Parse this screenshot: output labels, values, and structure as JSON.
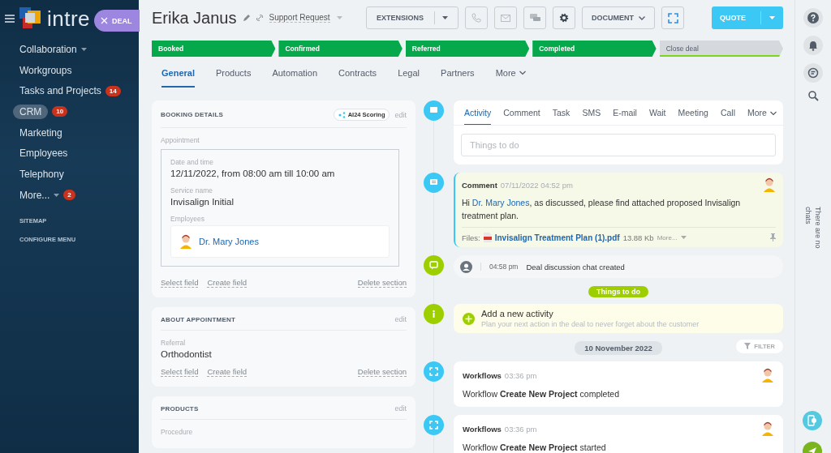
{
  "sidebar": {
    "logo": "intre",
    "deal_button": "DEAL",
    "items": [
      {
        "label": "Collaboration",
        "caret": true,
        "selected": false
      },
      {
        "label": "Workgroups",
        "caret": false,
        "selected": false
      },
      {
        "label": "Tasks and Projects",
        "badge": "14",
        "caret": false,
        "selected": false
      },
      {
        "label": "CRM",
        "badge": "10",
        "caret": false,
        "selected": true
      },
      {
        "label": "Marketing",
        "caret": false,
        "selected": false
      },
      {
        "label": "Employees",
        "caret": false,
        "selected": false
      },
      {
        "label": "Telephony",
        "caret": false,
        "selected": false
      },
      {
        "label": "More...",
        "badge": "2",
        "caret": true,
        "selected": false
      }
    ],
    "links": [
      "SITEMAP",
      "CONFIGURE MENU"
    ]
  },
  "header": {
    "title": "Erika Janus",
    "category": "Support Request",
    "extensions": "EXTENSIONS",
    "document": "DOCUMENT",
    "quote": "QUOTE"
  },
  "stages": [
    {
      "label": "Booked",
      "done": true
    },
    {
      "label": "Confirmed",
      "done": true
    },
    {
      "label": "Referred",
      "done": true
    },
    {
      "label": "Completed",
      "done": true
    },
    {
      "label": "Close deal",
      "done": false
    }
  ],
  "tabs": [
    {
      "label": "General",
      "selected": true
    },
    {
      "label": "Products",
      "selected": false
    },
    {
      "label": "Automation",
      "selected": false
    },
    {
      "label": "Contracts",
      "selected": false
    },
    {
      "label": "Legal",
      "selected": false
    },
    {
      "label": "Partners",
      "selected": false
    },
    {
      "label": "More",
      "selected": false
    }
  ],
  "sections": [
    {
      "title": "BOOKING DETAILS",
      "scoring": "AI24 Scoring",
      "edit": "edit",
      "kind": "booking",
      "group_label": "Appointment",
      "fields": [
        {
          "label": "Date and time",
          "value": "12/11/2022, from 08:00 am till 10:00 am"
        },
        {
          "label": "Service name",
          "value": "Invisalign Initial"
        }
      ],
      "employees_label": "Employees",
      "employee": "Dr. Mary Jones",
      "actions": [
        "Select field",
        "Create field"
      ],
      "delete": "Delete section"
    },
    {
      "title": "ABOUT APPOINTMENT",
      "edit": "edit",
      "kind": "plain",
      "fields": [
        {
          "label": "Referral",
          "value": "Orthodontist"
        }
      ],
      "actions": [
        "Select field",
        "Create field"
      ],
      "delete": "Delete section"
    },
    {
      "title": "PRODUCTS",
      "edit": "edit",
      "kind": "plain",
      "fields": [
        {
          "label": "Procedure"
        }
      ]
    }
  ],
  "activity_tabs": [
    {
      "label": "Activity",
      "selected": true
    },
    {
      "label": "Comment",
      "selected": false
    },
    {
      "label": "Task",
      "selected": false
    },
    {
      "label": "SMS",
      "selected": false
    },
    {
      "label": "E-mail",
      "selected": false
    },
    {
      "label": "Wait",
      "selected": false
    },
    {
      "label": "Meeting",
      "selected": false
    },
    {
      "label": "Call",
      "selected": false
    },
    {
      "label": "More",
      "selected": false
    }
  ],
  "activity_placeholder": "Things to do",
  "timeline": [
    {
      "kind": "comment",
      "title": "Comment",
      "time": "07/11/2022 04:52 pm",
      "link": "Dr. Mary Jones",
      "text_after": ", as discussed, please find attached proposed Invisalign treatment plan.",
      "text_before": "Hi",
      "files_label": "Files:",
      "file": "Invisalign Treatment Plan (1).pdf",
      "size": "13.88 Kb",
      "more": "More..."
    },
    {
      "kind": "system",
      "time": "04:58 pm",
      "text": "Deal discussion chat created"
    },
    {
      "kind": "divider",
      "label": "Things to do"
    },
    {
      "kind": "add",
      "title": "Add a new activity",
      "text": "Plan your next action in the deal to never forget about the customer"
    },
    {
      "kind": "date",
      "label": "10 November 2022",
      "filter": "FILTER"
    },
    {
      "kind": "workflow",
      "title": "Workflows",
      "time": "03:36 pm",
      "text": "Workflow **Create New Project** completed"
    },
    {
      "kind": "workflow",
      "title": "Workflows",
      "time": "03:36 pm",
      "text": "Workflow **Create New Project** started"
    }
  ],
  "right_rail": {
    "empty_text": "There are no chats"
  }
}
